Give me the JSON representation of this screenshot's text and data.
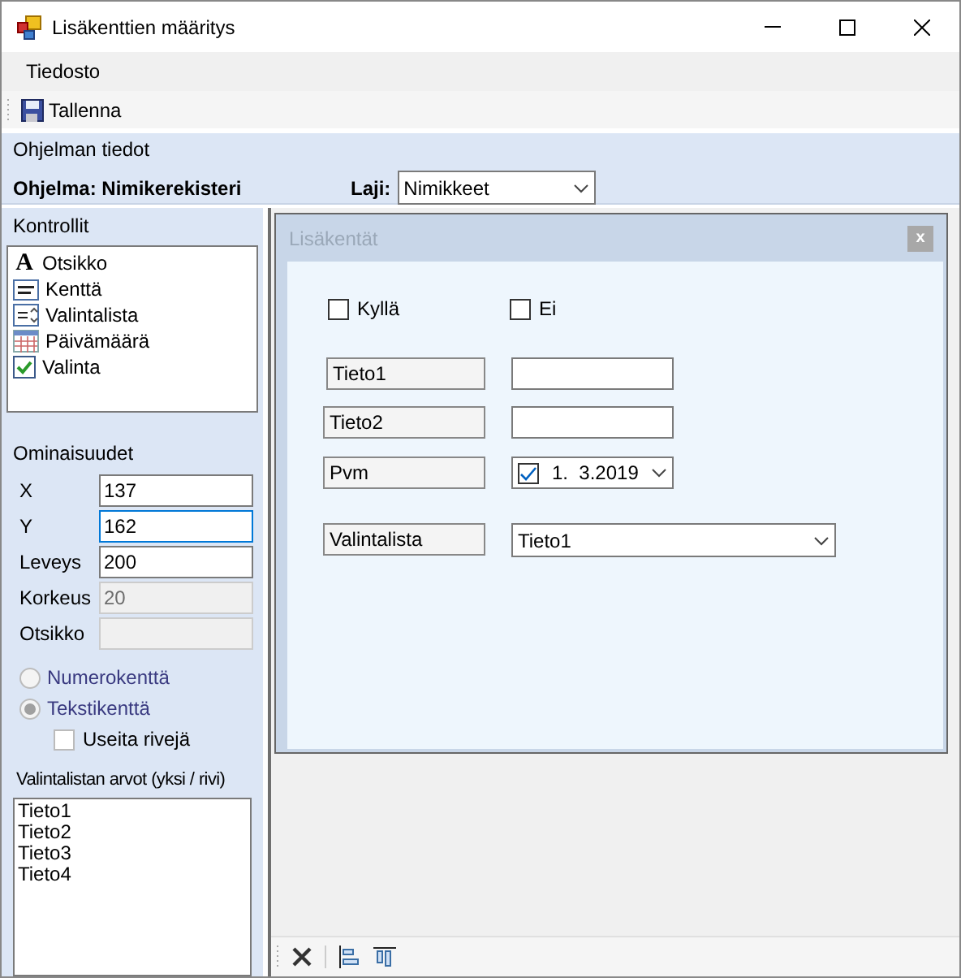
{
  "window": {
    "title": "Lisäkenttien määritys"
  },
  "menu": [
    "Tiedosto"
  ],
  "toolbar": [
    {
      "label": "Tallenna"
    }
  ],
  "program_info": {
    "title": "Ohjelman tiedot",
    "program": "Ohjelma: Nimikerekisteri",
    "type_label": "Laji:",
    "type_value": "Nimikkeet"
  },
  "controls": {
    "title": "Kontrollit",
    "items": [
      {
        "kind": "label",
        "glyph": "A",
        "label": "Otsikko"
      },
      {
        "kind": "field",
        "label": "Kenttä"
      },
      {
        "kind": "list",
        "label": "Valintalista"
      },
      {
        "kind": "date",
        "label": "Päivämäärä"
      },
      {
        "kind": "check",
        "label": "Valinta"
      }
    ]
  },
  "properties": {
    "title": "Ominaisuudet",
    "fields": [
      {
        "label": "X",
        "value": "137",
        "disabled": false,
        "focused": false
      },
      {
        "label": "Y",
        "value": "162",
        "disabled": false,
        "focused": true
      },
      {
        "label": "Leveys",
        "value": "200",
        "disabled": false,
        "focused": false
      },
      {
        "label": "Korkeus",
        "value": "20",
        "disabled": true,
        "focused": false
      },
      {
        "label": "Otsikko",
        "disabled": true,
        "focused": false
      }
    ],
    "radios": [
      {
        "label": "Numerokenttä",
        "selected": false,
        "disabled": true
      },
      {
        "label": "Tekstikenttä",
        "selected": true,
        "disabled": true
      }
    ],
    "multiline": {
      "label": "Useita rivejä",
      "checked": false
    },
    "list_title": "Valintalistan arvot (yksi / rivi)",
    "list_values": [
      "Tieto1",
      "Tieto2",
      "Tieto3",
      "Tieto4"
    ]
  },
  "designer": {
    "title": "Lisäkentät",
    "close": "x",
    "checkboxes": [
      {
        "label": "Kyllä",
        "checked": false
      },
      {
        "label": "Ei",
        "checked": false
      }
    ],
    "rows": [
      {
        "kind": "text",
        "label": "Tieto1"
      },
      {
        "kind": "text",
        "label": "Tieto2"
      },
      {
        "kind": "date",
        "label": "Pvm",
        "value": "1.  3.2019",
        "checked": true
      },
      {
        "kind": "combo",
        "label": "Valintalista",
        "value": "Tieto1"
      }
    ]
  }
}
